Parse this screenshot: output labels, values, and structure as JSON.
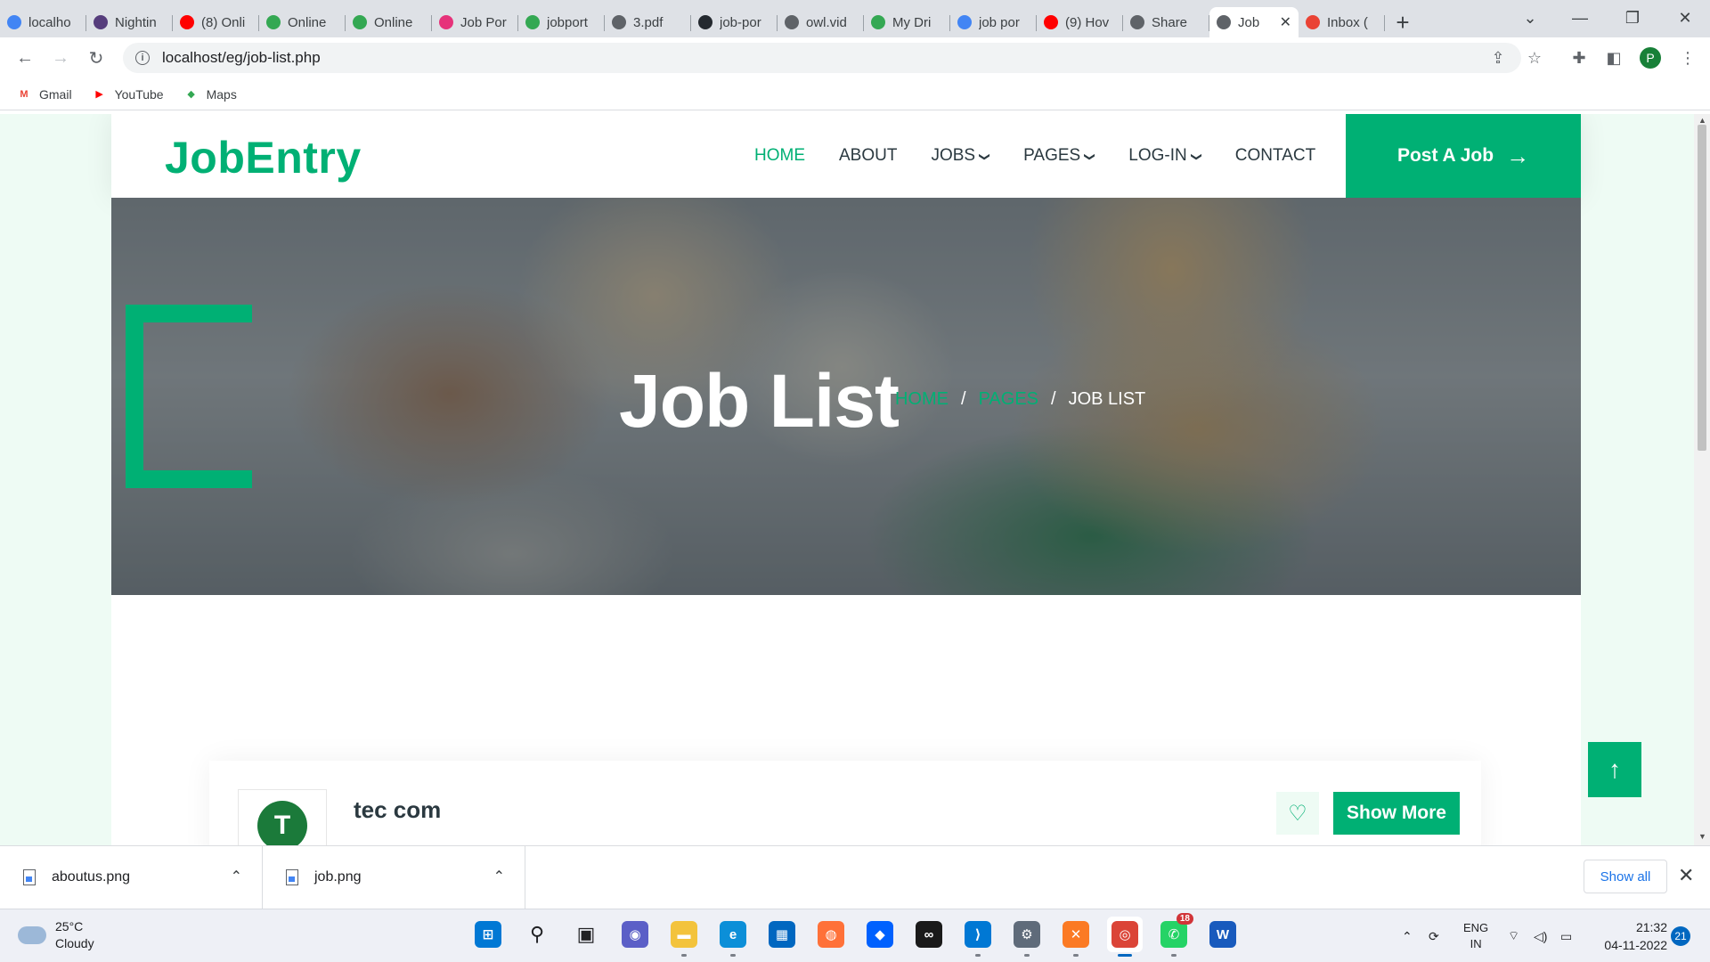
{
  "browser": {
    "tabs": [
      {
        "title": "localho",
        "favicon": "google-g",
        "color": "#4285f4"
      },
      {
        "title": "Nightin",
        "favicon": "bootstrap-b",
        "color": "#563d7c"
      },
      {
        "title": "(8) Onli",
        "favicon": "youtube",
        "color": "#ff0000"
      },
      {
        "title": "Online",
        "favicon": "google-drive",
        "color": "#34a853"
      },
      {
        "title": "Online",
        "favicon": "google-drive",
        "color": "#34a853"
      },
      {
        "title": "Job Por",
        "favicon": "cube",
        "color": "#e6327a"
      },
      {
        "title": "jobport",
        "favicon": "google-drive",
        "color": "#34a853"
      },
      {
        "title": "3.pdf",
        "favicon": "globe",
        "color": "#5f6368"
      },
      {
        "title": "job-por",
        "favicon": "github",
        "color": "#24292f"
      },
      {
        "title": "owl.vid",
        "favicon": "globe",
        "color": "#5f6368"
      },
      {
        "title": "My Dri",
        "favicon": "google-drive",
        "color": "#34a853"
      },
      {
        "title": "job por",
        "favicon": "google-g",
        "color": "#4285f4"
      },
      {
        "title": "(9) Hov",
        "favicon": "youtube",
        "color": "#ff0000"
      },
      {
        "title": "Share",
        "favicon": "globe",
        "color": "#5f6368"
      }
    ],
    "active_tab": {
      "title": "Job",
      "favicon": "globe"
    },
    "after_tab": {
      "title": "Inbox (",
      "favicon": "gmail",
      "color": "#ea4335"
    },
    "new_tab_label": "+",
    "url": "localhost/eg/job-list.php",
    "profile_initial": "P",
    "bookmarks": [
      {
        "label": "Gmail",
        "icon": "gmail-icon",
        "color": "#ea4335",
        "glyph": "M"
      },
      {
        "label": "YouTube",
        "icon": "youtube-icon",
        "color": "#ff0000",
        "glyph": "▶"
      },
      {
        "label": "Maps",
        "icon": "maps-icon",
        "color": "#34a853",
        "glyph": "◆"
      }
    ]
  },
  "site": {
    "brand": "JobEntry",
    "accent_color": "#00b074",
    "nav": [
      {
        "label": "Home",
        "active": true,
        "dropdown": false
      },
      {
        "label": "About",
        "active": false,
        "dropdown": false
      },
      {
        "label": "Jobs",
        "active": false,
        "dropdown": true
      },
      {
        "label": "Pages",
        "active": false,
        "dropdown": true
      },
      {
        "label": "Log-In",
        "active": false,
        "dropdown": true
      },
      {
        "label": "Contact",
        "active": false,
        "dropdown": false
      }
    ],
    "post_job_label": "Post A Job",
    "hero": {
      "title": "Job List",
      "breadcrumb": [
        {
          "label": "Home",
          "link": true
        },
        {
          "label": "/",
          "link": false
        },
        {
          "label": "Pages",
          "link": true
        },
        {
          "label": "/",
          "link": false
        },
        {
          "label": "Job List",
          "link": false
        }
      ]
    },
    "job": {
      "company": "tec com",
      "show_more_label": "Show More",
      "favorite_icon": "heart-icon"
    },
    "back_to_top_icon": "arrow-up-icon"
  },
  "downloads": {
    "items": [
      {
        "name": "aboutus.png"
      },
      {
        "name": "job.png"
      }
    ],
    "show_all_label": "Show all"
  },
  "taskbar": {
    "weather": {
      "temp": "25°C",
      "condition": "Cloudy"
    },
    "apps": [
      {
        "name": "windows-start",
        "glyph": "⊞",
        "color": "#0078d4",
        "running": false
      },
      {
        "name": "search",
        "glyph": "⚲",
        "color": "#202124",
        "running": false
      },
      {
        "name": "task-view",
        "glyph": "▣",
        "color": "#202124",
        "running": false
      },
      {
        "name": "teams-chat",
        "glyph": "◉",
        "color": "#5b5fc7",
        "running": false
      },
      {
        "name": "file-explorer",
        "glyph": "▬",
        "color": "#f3c33c",
        "running": true
      },
      {
        "name": "edge",
        "glyph": "e",
        "color": "#0c8fd8",
        "running": true
      },
      {
        "name": "microsoft-store",
        "glyph": "▦",
        "color": "#0067c0",
        "running": false
      },
      {
        "name": "firefox",
        "glyph": "◍",
        "color": "#ff7139",
        "running": false
      },
      {
        "name": "dropbox",
        "glyph": "◆",
        "color": "#0061fe",
        "running": false
      },
      {
        "name": "creative-cloud",
        "glyph": "∞",
        "color": "#1a1a1a",
        "running": false
      },
      {
        "name": "vs-code",
        "glyph": "⟩",
        "color": "#0078d4",
        "running": true
      },
      {
        "name": "settings",
        "glyph": "⚙",
        "color": "#5f6b7a",
        "running": true
      },
      {
        "name": "xampp",
        "glyph": "✕",
        "color": "#fb7a24",
        "running": true
      },
      {
        "name": "chrome",
        "glyph": "◎",
        "color": "#db4437",
        "running": true,
        "focused": true
      },
      {
        "name": "whatsapp",
        "glyph": "✆",
        "color": "#25d366",
        "running": true,
        "badge": "18"
      },
      {
        "name": "word",
        "glyph": "W",
        "color": "#185abd",
        "running": false
      }
    ],
    "tray": {
      "language": "ENG",
      "region": "IN"
    },
    "clock": {
      "time": "21:32",
      "date": "04-11-2022"
    },
    "notifications": "21"
  }
}
